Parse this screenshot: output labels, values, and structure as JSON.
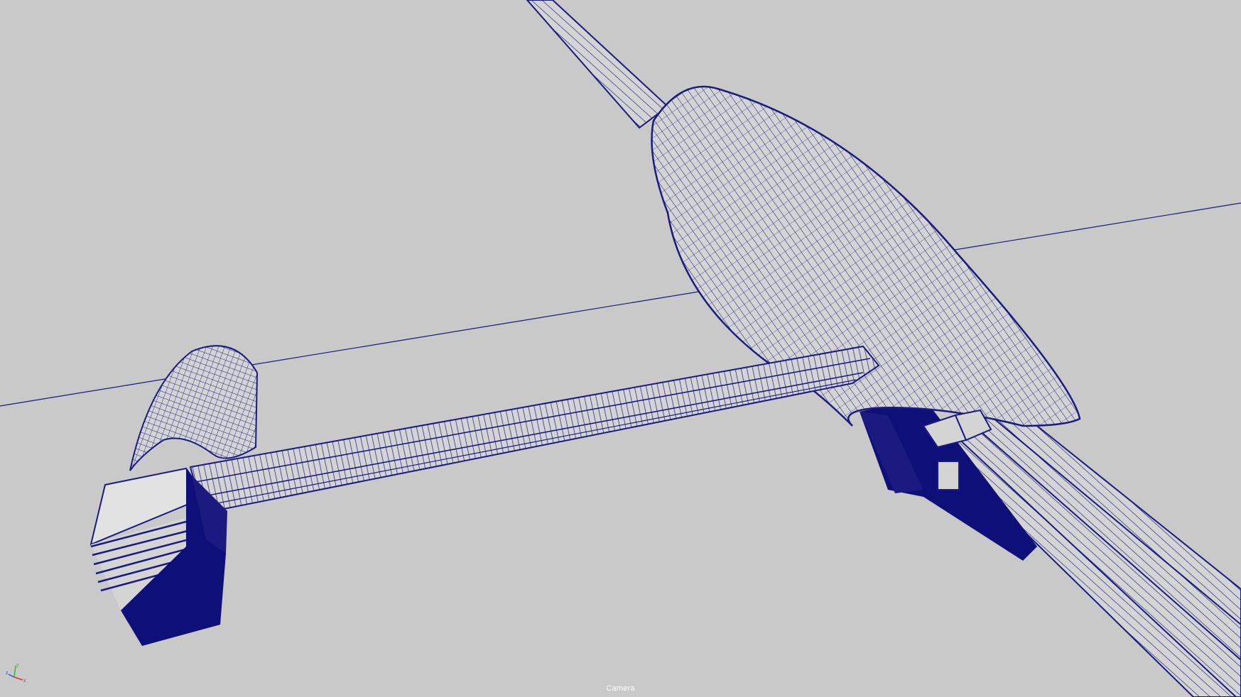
{
  "viewport": {
    "camera_label": "Camera",
    "background_color": "#c9c9c9",
    "wire_color": "#1a1a80",
    "fill_dark": "#0f0f7a",
    "fill_light": "#d4d4d4"
  },
  "axis_gizmo": {
    "x_label": "x",
    "y_label": "y",
    "z_label": "z",
    "x_color": "#e03030",
    "y_color": "#30c030",
    "z_color": "#3050e0"
  }
}
